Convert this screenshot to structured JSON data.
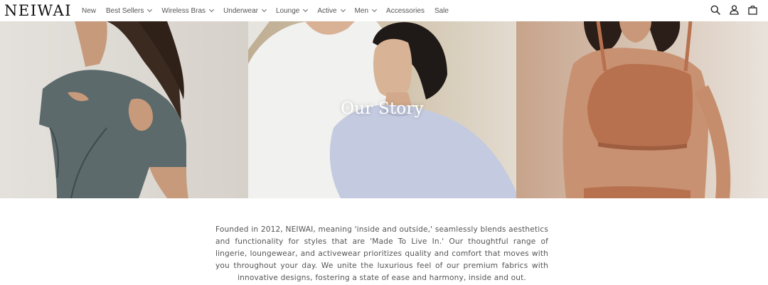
{
  "brand": {
    "logo": "NEIWAI"
  },
  "nav": {
    "items": [
      {
        "label": "New",
        "has_dropdown": false
      },
      {
        "label": "Best Sellers",
        "has_dropdown": true
      },
      {
        "label": "Wireless Bras",
        "has_dropdown": true
      },
      {
        "label": "Underwear",
        "has_dropdown": true
      },
      {
        "label": "Lounge",
        "has_dropdown": true
      },
      {
        "label": "Active",
        "has_dropdown": true
      },
      {
        "label": "Men",
        "has_dropdown": true
      },
      {
        "label": "Accessories",
        "has_dropdown": false
      },
      {
        "label": "Sale",
        "has_dropdown": false
      }
    ]
  },
  "header_icons": [
    "search-icon",
    "account-icon",
    "cart-icon"
  ],
  "hero": {
    "title": "Our Story",
    "images": [
      {
        "icon": "woman-grey-cutout-top-photo"
      },
      {
        "icon": "couple-white-and-blue-tees-photo"
      },
      {
        "icon": "woman-terracotta-bralette-photo"
      }
    ]
  },
  "story": {
    "text": "Founded in 2012, NEIWAI, meaning 'inside and outside,' seamlessly blends aesthetics and functionality for styles that are 'Made To Live In.' Our thoughtful range of lingerie, loungewear, and activewear prioritizes quality and comfort that moves with you throughout your day. We unite the luxurious feel of our premium fabrics with innovative designs, fostering a state of ease and harmony, inside and out."
  },
  "colors": {
    "text": "#555555",
    "header_bg": "#ffffff",
    "hero_title": "#ffffff"
  }
}
